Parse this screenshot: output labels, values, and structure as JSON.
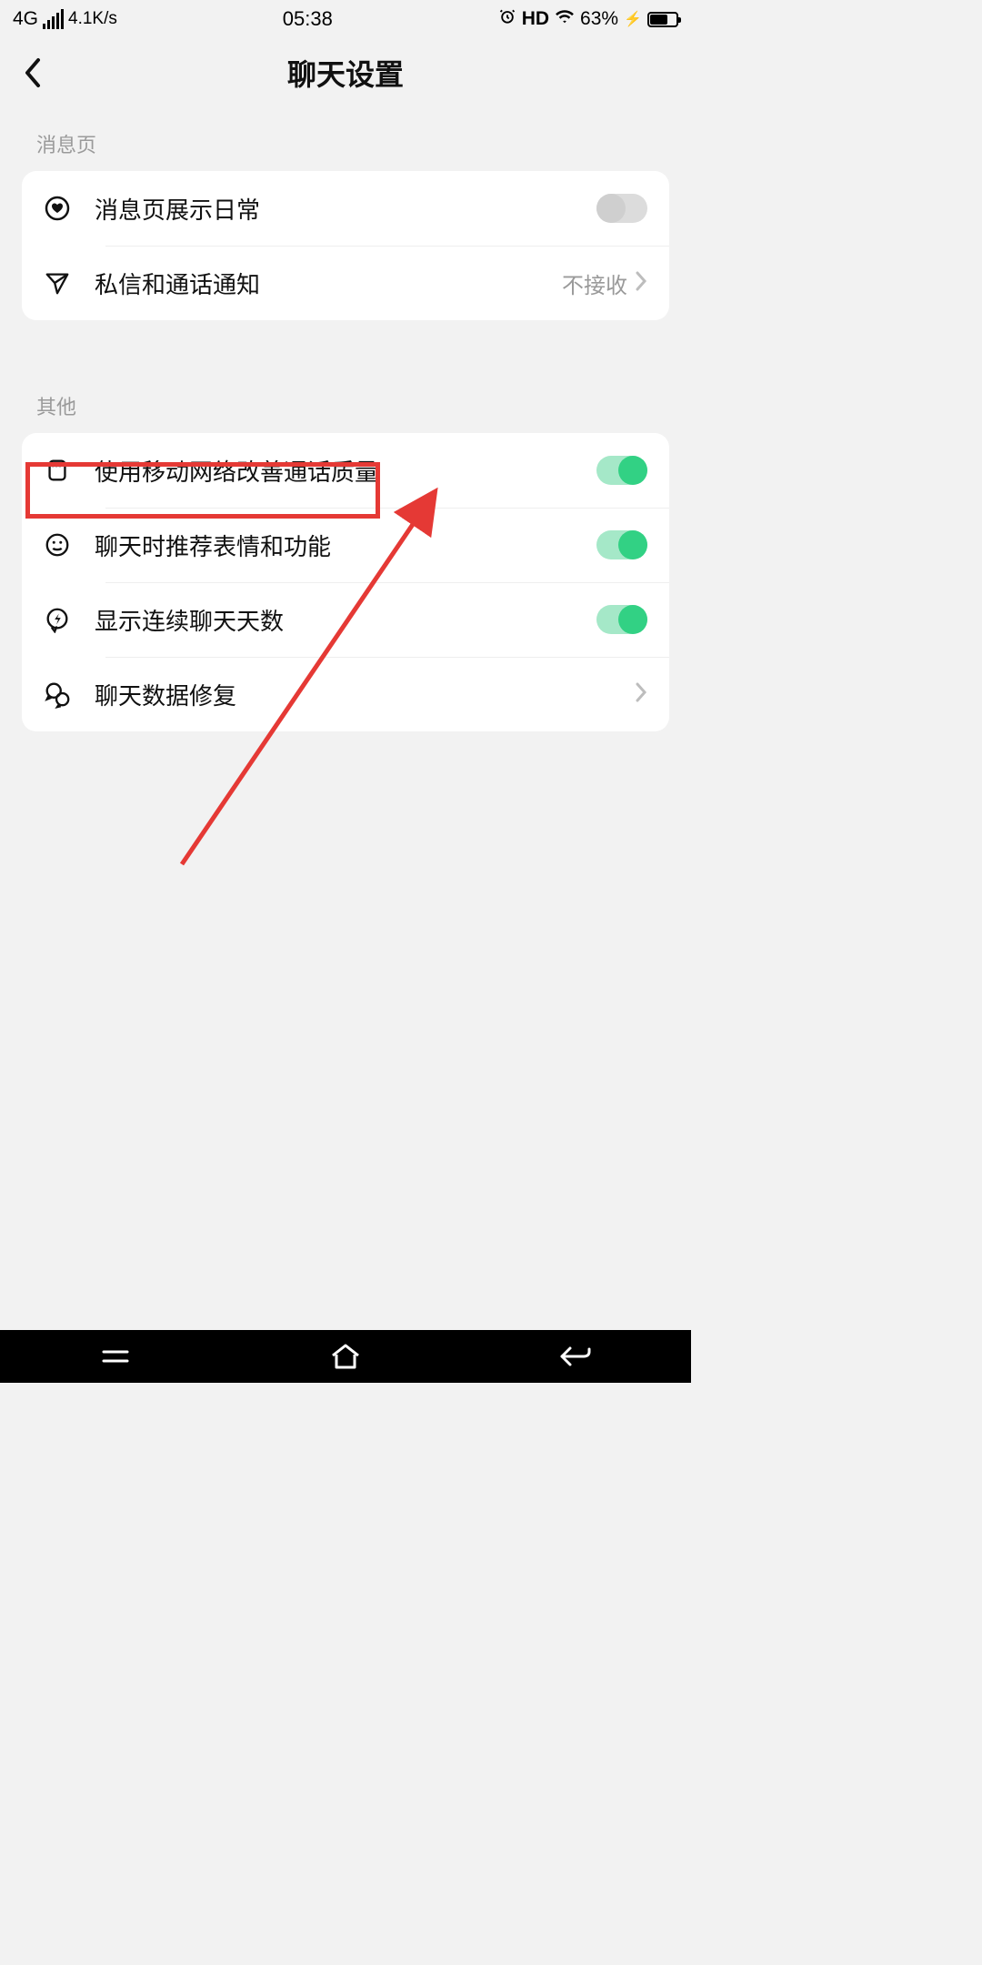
{
  "status": {
    "network": "4G",
    "speed": "4.1K/s",
    "time": "05:38",
    "hd": "HD",
    "battery_pct": "63%"
  },
  "header": {
    "title": "聊天设置"
  },
  "sections": {
    "messages": {
      "label": "消息页",
      "items": [
        {
          "label": "消息页展示日常",
          "toggle": false
        },
        {
          "label": "私信和通话通知",
          "value": "不接收"
        }
      ]
    },
    "other": {
      "label": "其他",
      "items": [
        {
          "label": "使用移动网络改善通话质量",
          "toggle": true
        },
        {
          "label": "聊天时推荐表情和功能",
          "toggle": true
        },
        {
          "label": "显示连续聊天天数",
          "toggle": true
        },
        {
          "label": "聊天数据修复"
        }
      ]
    }
  },
  "annotation": {
    "highlight_item_index": 1,
    "color": "#e53935"
  }
}
